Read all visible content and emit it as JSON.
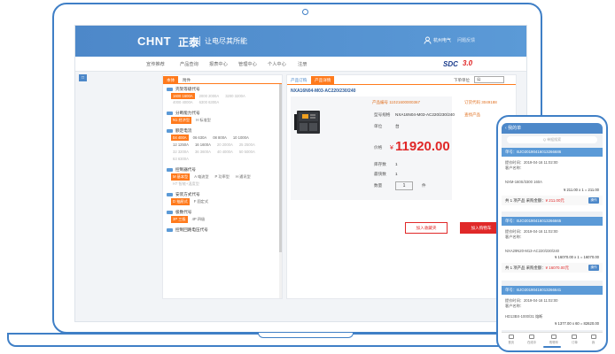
{
  "header": {
    "brand": "CHNT",
    "brand_cn": "正泰",
    "site_name": "让电尽其所能",
    "user_name": "杭州电气",
    "user_menu": "问题反馈"
  },
  "nav": {
    "items": [
      "宣传推荐",
      "产品查询",
      "报表中心",
      "管理中心",
      "个人中心",
      "注册"
    ],
    "logo": "SDC",
    "logo_num": "3.0"
  },
  "side_marker": "□",
  "left": {
    "tabs": [
      "本体",
      "附件"
    ],
    "groups": [
      {
        "title": "壳架等级代号",
        "rows": [
          [
            "1600 1600A",
            "2000 2000A",
            "3200 3200A"
          ],
          [
            "4000 4000A",
            "6300 6300A"
          ]
        ],
        "selected": "1600 1600A"
      },
      {
        "title": "分断能力代号",
        "rows": [
          [
            "N1 经济型",
            "H 标准型"
          ]
        ],
        "selected": "N1 经济型"
      },
      {
        "title": "额定电流",
        "rows": [
          [
            "04 400A",
            "06 630A",
            "08 800A",
            "10 1000A"
          ],
          [
            "12 1250A",
            "16 1600A",
            "20 2000A",
            "25 2500A"
          ],
          [
            "32 3200A",
            "36 3600A",
            "40 4000A",
            "50 5000A"
          ],
          [
            "63 6300A"
          ]
        ],
        "selected": "04 400A"
      },
      {
        "title": "控制器代号",
        "rows": [
          [
            "M 基本型",
            "A 电流型",
            "P 功率型",
            "H 通讯型"
          ],
          [
            "H7 智能+温度型"
          ]
        ],
        "selected": "M 基本型"
      },
      {
        "title": "安装方式代号",
        "rows": [
          [
            "D 抽屉式",
            "F 固定式"
          ]
        ],
        "selected": "D 抽屉式"
      },
      {
        "title": "极数代号",
        "rows": [
          [
            "3P 三极",
            "4P 四极"
          ]
        ],
        "selected": "3P 三极"
      },
      {
        "title": "控制回路电压代号",
        "rows": []
      }
    ]
  },
  "right": {
    "tabs": [
      "产品订购",
      "产品详情"
    ],
    "unit_label": "下单单位",
    "unit_value": "公",
    "product_title": "NXA16N04-M03-AC220/230/240",
    "code_label": "产品编号",
    "code_value": "11021600000367",
    "code_right": "订货代码 3049188",
    "model_label": "型号规格",
    "model_value": "NXA16N04-M03-AC220/230/240",
    "model_link": "查找产品",
    "unit2_label": "单位",
    "unit2_value": "台",
    "price_label": "价格",
    "price_yen": "¥",
    "price": "11920.00",
    "stock1_label": "库存数",
    "stock1_value": "1",
    "stock2_label": "最快数",
    "stock2_value": "1",
    "qty_label": "数量",
    "qty_value": "1",
    "qty_unit": "件",
    "btn_cart": "加入收藏夹",
    "btn_buy": "加入购物车"
  },
  "phone": {
    "title": "我的单",
    "search_placeholder": "Q  单据搜索",
    "orders": [
      {
        "id": "单号：BJO20190416013266686",
        "time": "提价时间：2019-04-16 11:02:00",
        "customer": "客户名称：",
        "item": "NXM-160S/3300 160A",
        "line": "¥ 211.00 x 1 = 211.00",
        "summary": "共 1 项产品 采购金额：",
        "amount": "¥ 211.00元",
        "pay": "操作"
      },
      {
        "id": "单号：BJO20190416013266665",
        "time": "提价时间：2019-04-16 11:02:00",
        "customer": "客户名称：",
        "item": "NXA29N20-M13-AC220/230/240",
        "line": "¥ 16070.00 x 1 = 16070.00",
        "summary": "共 1 项产品 采购金额：",
        "amount": "¥ 16070.00元",
        "pay": "操作"
      },
      {
        "id": "单号：BJO20190416013266641",
        "time": "提价时间：2019-04-16 11:02:00",
        "customer": "客户名称：",
        "item": "HD13BX-1000/31 熔断",
        "line": "¥ 1377.00 x 60 = 82620.00",
        "summary": "",
        "amount": "",
        "pay": ""
      }
    ],
    "footer": [
      "首页",
      "在线中",
      "购物车",
      "订单",
      "我"
    ]
  },
  "colors": {
    "accent": "#4d88c9",
    "orange": "#ff7a1c",
    "red": "#e02828",
    "frame": "#3f7fc6"
  }
}
